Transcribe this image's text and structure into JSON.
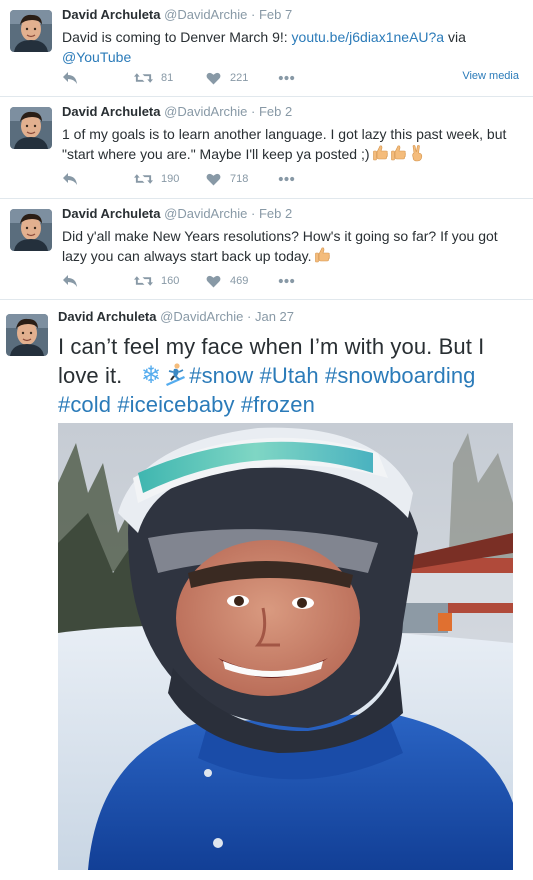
{
  "tweets": [
    {
      "name": "David Archuleta",
      "handle": "@DavidArchie",
      "time": "· Feb 7",
      "text_pre": "David is coming to Denver March 9!: ",
      "link1": "youtu.be/j6diax1neAU?a",
      "text_mid": " via",
      "link2": "@YouTube",
      "retweets": "81",
      "likes": "221",
      "view_media": "View media"
    },
    {
      "name": "David Archuleta",
      "handle": "@DavidArchie",
      "time": "· Feb 2",
      "text": "1 of my goals is to learn another language. I got lazy this past week, but \"start where you are.\"  Maybe I'll keep ya posted ;)",
      "retweets": "190",
      "likes": "718"
    },
    {
      "name": "David Archuleta",
      "handle": "@DavidArchie",
      "time": "· Feb 2",
      "text": "Did y'all make New Years resolutions?  How's it going so far?  If you got lazy you can always start back up today.",
      "retweets": "160",
      "likes": "469"
    },
    {
      "name": "David Archuleta",
      "handle": "@DavidArchie",
      "time": "· Jan 27",
      "text": "I can’t feel my face when I’m with you. But I love it.",
      "emoji1": "❄",
      "hashtags": [
        "#snow",
        "#Utah",
        "#snowboarding",
        "#cold",
        "#iceicebaby",
        "#frozen"
      ]
    }
  ],
  "icons": {
    "reply": "reply-icon",
    "retweet": "retweet-icon",
    "like": "heart-icon",
    "more": "more-icon"
  },
  "colors": {
    "link": "#2b7bb9",
    "meta": "#8899a6",
    "text": "#292f33",
    "divider": "#e1e8ed"
  }
}
